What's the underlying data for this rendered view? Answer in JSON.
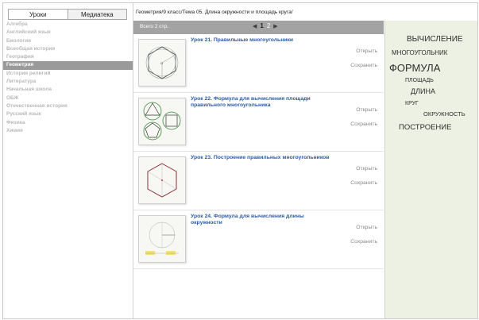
{
  "sidebar": {
    "tabs": [
      {
        "label": "Уроки"
      },
      {
        "label": "Медиатека"
      }
    ],
    "subjects": [
      "Алгебра",
      "Английский язык",
      "Биология",
      "Всеобщая история",
      "География",
      "Геометрия",
      "История религий",
      "Литература",
      "Начальная школа",
      "ОБЖ",
      "Отечественная история",
      "Русский язык",
      "Физика",
      "Химия"
    ],
    "active_subject": "Геометрия"
  },
  "breadcrumb": "Геометрия/9 класс/Тема 05. Длина окружности и площадь круга/",
  "pager": {
    "total_label": "Всего 2 стр.",
    "pages": [
      "1",
      "2"
    ],
    "current": "1",
    "prev_icon": "triangle-left",
    "next_icon": "triangle-right"
  },
  "lessons": [
    {
      "title": "Урок 21. Правильные многоугольники",
      "open": "Открыть",
      "save": "Сохранить"
    },
    {
      "title": "Урок 22. Формула для вычисления площади правильного многоугольника",
      "open": "Открыть",
      "save": "Сохранить"
    },
    {
      "title": "Урок 23. Построение правильных многоугольников",
      "open": "Открыть",
      "save": "Сохранить"
    },
    {
      "title": "Урок 24. Формула для вычисления длины окружности",
      "open": "Открыть",
      "save": "Сохранить"
    }
  ],
  "tags": [
    "ВЫЧИСЛЕНИЕ",
    "МНОГОУГОЛЬНИК",
    "ФОРМУЛА",
    "ПЛОЩАДЬ",
    "ДЛИНА",
    "КРУГ",
    "ОКРУЖНОСТЬ",
    "ПОСТРОЕНИЕ"
  ],
  "colors": {
    "accent": "#2a59a8",
    "sidebar_active": "#9a9a9a",
    "panel_bg": "#edf1e4"
  }
}
